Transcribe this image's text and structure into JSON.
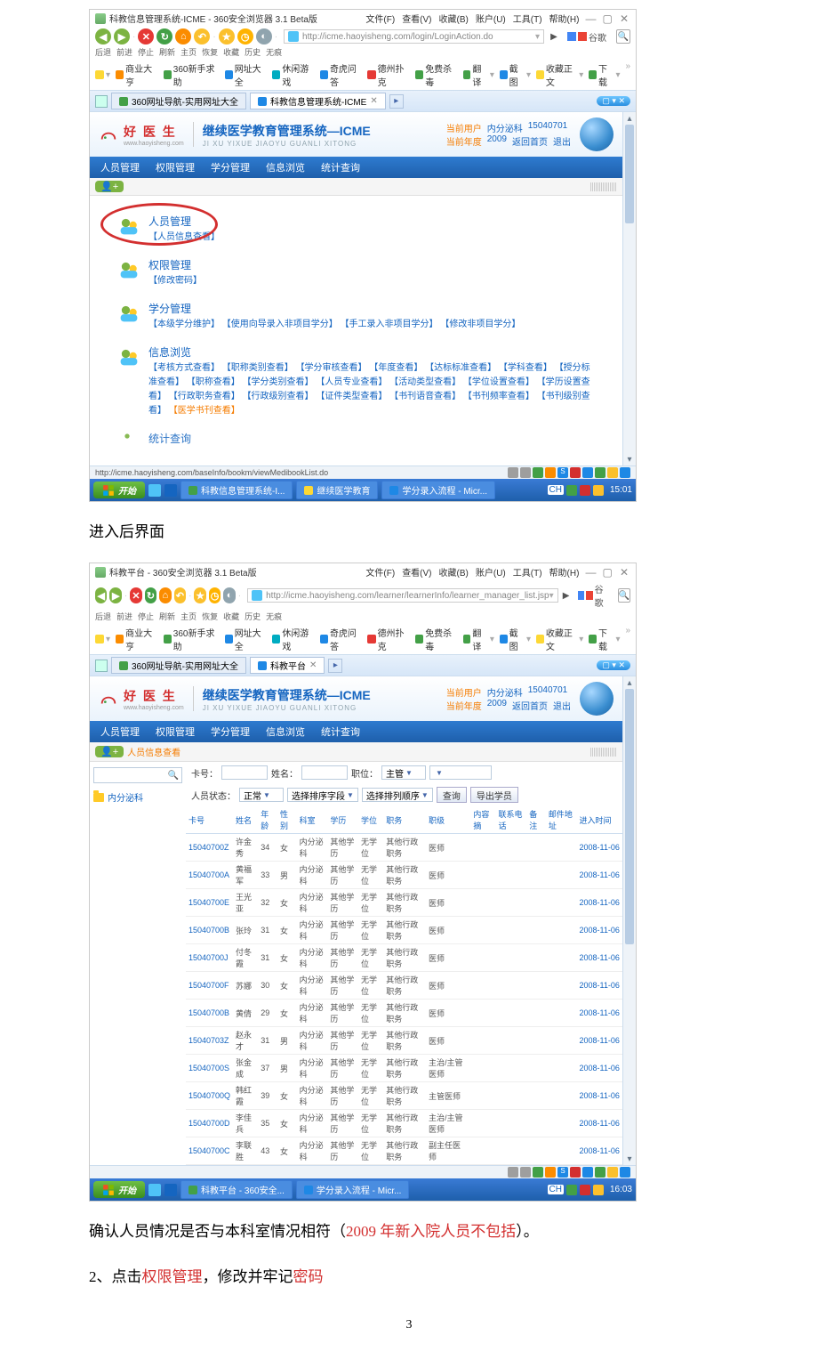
{
  "para_intro": "进入后界面",
  "para_confirm_prefix": "确认人员情况是否与本科室情况相符（",
  "para_confirm_red": "2009 年新入院人员不包括",
  "para_confirm_suffix": "）。",
  "para_step2_a": "2、点击",
  "para_step2_b": "权限管理",
  "para_step2_c": "，修改并牢记",
  "para_step2_d": "密码",
  "page_number": "3",
  "titlebar_menu": [
    "文件(F)",
    "查看(V)",
    "收藏(B)",
    "账户(U)",
    "工具(T)",
    "帮助(H)"
  ],
  "nav_labels": [
    "后退",
    "前进",
    "停止",
    "刷新",
    "主页",
    "恢复",
    "收藏",
    "历史",
    "无痕"
  ],
  "search_engine": "谷歌",
  "bookmarks_left": [
    "商业大亨",
    "360新手求助",
    "网址大全",
    "休闲游戏",
    "奇虎问答",
    "德州扑克",
    "免费杀毒"
  ],
  "bookmarks_right": [
    "翻译",
    "截图",
    "收藏正文",
    "下载"
  ],
  "tabbar_restore": "360网址导航-实用网址大全",
  "s1": {
    "title": "科教信息管理系统-ICME - 360安全浏览器 3.1 Beta版",
    "url": "http://icme.haoyisheng.com/login/LoginAction.do",
    "tab_active": "科教信息管理系统-ICME",
    "logo_main": "好 医 生",
    "logo_sub": "www.haoyisheng.com",
    "sys_title": "继续医学教育管理系统—ICME",
    "sys_sub": "JI XU YIXUE JIAOYU GUANLI XITONG",
    "user_row1": {
      "lbl": "当前用户",
      "dept": "内分泌科",
      "uid": "15040701"
    },
    "user_row2": {
      "lbl": "当前年度",
      "year": "2009",
      "back": "返回首页",
      "exit": "退出"
    },
    "nav_items": [
      "人员管理",
      "权限管理",
      "学分管理",
      "信息浏览",
      "统计查询"
    ],
    "sections": [
      {
        "title": "人员管理",
        "links": [
          "【人员信息查看】"
        ],
        "highlight": true
      },
      {
        "title": "权限管理",
        "links": [
          "【修改密码】"
        ]
      },
      {
        "title": "学分管理",
        "links": [
          "【本级学分维护】",
          "【使用向导录入非项目学分】",
          "【手工录入非项目学分】",
          "【修改非项目学分】"
        ]
      },
      {
        "title": "信息浏览",
        "links": [
          "【考核方式查看】",
          "【职称类别查看】",
          "【学分审核查看】",
          "【年度查看】",
          "【达标标准查看】",
          "【学科查看】",
          "【授分标准查看】",
          "【职称查看】",
          "【学分类别查看】",
          "【人员专业查看】",
          "【活动类型查看】",
          "【学位设置查看】",
          "【学历设置查看】",
          "【行政职务查看】",
          "【行政级别查看】",
          "【证件类型查看】",
          "【书刊语音查看】",
          "【书刊频率查看】",
          "【书刊级别查看】"
        ],
        "orange_tail": "【医学书刊查看】"
      },
      {
        "title": "统计查询",
        "truncated": true
      }
    ],
    "status_url": "http://icme.haoyisheng.com/baseInfo/bookm/viewMedibookList.do",
    "task_items": [
      "科教信息管理系统-I...",
      "继续医学教育",
      "学分录入流程 - Micr..."
    ],
    "clock": "15:01",
    "tray_lang": "CH"
  },
  "s2": {
    "title": "科教平台 - 360安全浏览器 3.1 Beta版",
    "url": "http://icme.haoyisheng.com/learner/learnerInfo/learner_manager_list.jsp",
    "tab_active": "科教平台",
    "breadcrumb": "人员信息查看",
    "sidebar_folder": "内分泌科",
    "filter": {
      "card_lbl": "卡号：",
      "name_lbl": "姓名：",
      "post_lbl": "职位：",
      "status_lbl": "人员状态：",
      "status_val": "正常",
      "sort_field_lbl": "选择排序字段",
      "sort_order_lbl": "选择排列顺序",
      "btn_query": "查询",
      "btn_export": "导出学员",
      "post_val": "主管"
    },
    "columns": [
      "卡号",
      "姓名",
      "年龄",
      "性别",
      "科室",
      "学历",
      "学位",
      "职务",
      "职级",
      "内容摘",
      "联系电话",
      "备注",
      "邮件地址",
      "进入时间"
    ],
    "rows": [
      {
        "card": "15040700Z",
        "name": "许金秀",
        "age": "34",
        "sex": "女",
        "dept": "内分泌科",
        "edu": "其他学历",
        "deg": "无学位",
        "duty": "其他行政职务",
        "rank": "医师",
        "date": "2008-11-06"
      },
      {
        "card": "15040700A",
        "name": "黄福军",
        "age": "33",
        "sex": "男",
        "dept": "内分泌科",
        "edu": "其他学历",
        "deg": "无学位",
        "duty": "其他行政职务",
        "rank": "医师",
        "date": "2008-11-06"
      },
      {
        "card": "15040700E",
        "name": "王光亚",
        "age": "32",
        "sex": "女",
        "dept": "内分泌科",
        "edu": "其他学历",
        "deg": "无学位",
        "duty": "其他行政职务",
        "rank": "医师",
        "date": "2008-11-06"
      },
      {
        "card": "15040700B",
        "name": "张玲",
        "age": "31",
        "sex": "女",
        "dept": "内分泌科",
        "edu": "其他学历",
        "deg": "无学位",
        "duty": "其他行政职务",
        "rank": "医师",
        "date": "2008-11-06"
      },
      {
        "card": "15040700J",
        "name": "付冬霞",
        "age": "31",
        "sex": "女",
        "dept": "内分泌科",
        "edu": "其他学历",
        "deg": "无学位",
        "duty": "其他行政职务",
        "rank": "医师",
        "date": "2008-11-06"
      },
      {
        "card": "15040700F",
        "name": "苏娜",
        "age": "30",
        "sex": "女",
        "dept": "内分泌科",
        "edu": "其他学历",
        "deg": "无学位",
        "duty": "其他行政职务",
        "rank": "医师",
        "date": "2008-11-06"
      },
      {
        "card": "15040700B",
        "name": "黄倩",
        "age": "29",
        "sex": "女",
        "dept": "内分泌科",
        "edu": "其他学历",
        "deg": "无学位",
        "duty": "其他行政职务",
        "rank": "医师",
        "date": "2008-11-06"
      },
      {
        "card": "15040703Z",
        "name": "赵永才",
        "age": "31",
        "sex": "男",
        "dept": "内分泌科",
        "edu": "其他学历",
        "deg": "无学位",
        "duty": "其他行政职务",
        "rank": "医师",
        "date": "2008-11-06"
      },
      {
        "card": "15040700S",
        "name": "张金成",
        "age": "37",
        "sex": "男",
        "dept": "内分泌科",
        "edu": "其他学历",
        "deg": "无学位",
        "duty": "其他行政职务",
        "rank": "主治/主管医师",
        "date": "2008-11-06"
      },
      {
        "card": "15040700Q",
        "name": "韩红霞",
        "age": "39",
        "sex": "女",
        "dept": "内分泌科",
        "edu": "其他学历",
        "deg": "无学位",
        "duty": "其他行政职务",
        "rank": "主管医师",
        "date": "2008-11-06"
      },
      {
        "card": "15040700D",
        "name": "李佳兵",
        "age": "35",
        "sex": "女",
        "dept": "内分泌科",
        "edu": "其他学历",
        "deg": "无学位",
        "duty": "其他行政职务",
        "rank": "主治/主管医师",
        "date": "2008-11-06"
      },
      {
        "card": "15040700C",
        "name": "李联胜",
        "age": "43",
        "sex": "女",
        "dept": "内分泌科",
        "edu": "其他学历",
        "deg": "无学位",
        "duty": "其他行政职务",
        "rank": "副主任医师",
        "date": "2008-11-06"
      }
    ],
    "task_items": [
      "科教平台 - 360安全...",
      "学分录入流程 - Micr..."
    ],
    "clock": "16:03",
    "tray_lang": "CH"
  },
  "start_label": "开始"
}
